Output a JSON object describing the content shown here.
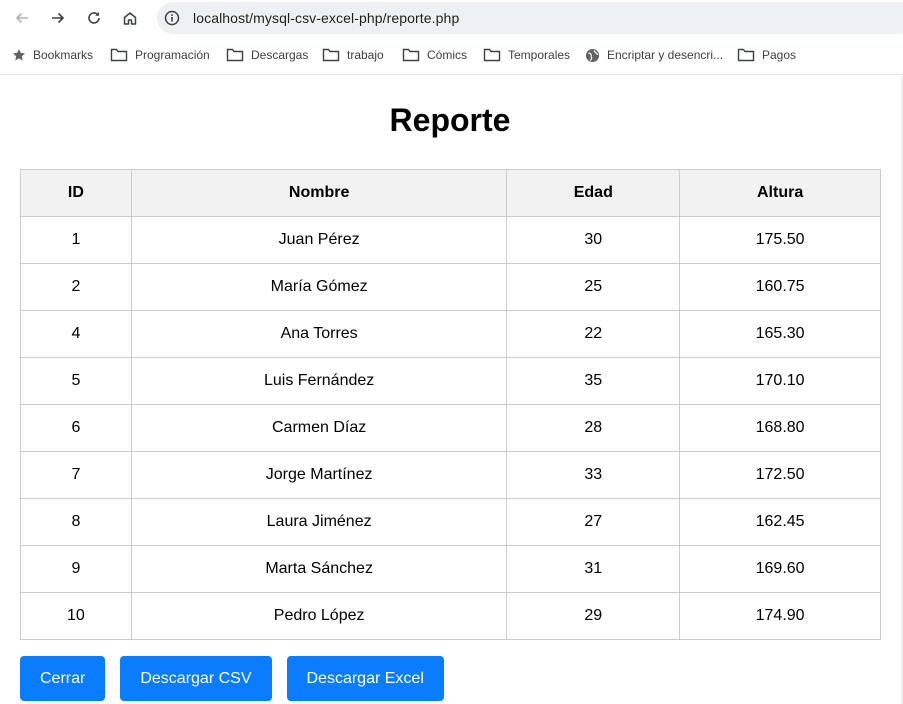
{
  "browser": {
    "url": "localhost/mysql-csv-excel-php/reporte.php",
    "bookmarks": [
      {
        "label": "Bookmarks",
        "icon": "star-icon"
      },
      {
        "label": "Programación",
        "icon": "folder-icon"
      },
      {
        "label": "Descargas",
        "icon": "folder-icon"
      },
      {
        "label": "trabajo",
        "icon": "folder-icon"
      },
      {
        "label": "Cómics",
        "icon": "folder-icon"
      },
      {
        "label": "Temporales",
        "icon": "folder-icon"
      },
      {
        "label": "Encriptar y desencri...",
        "icon": "globe-icon"
      },
      {
        "label": "Pagos",
        "icon": "folder-icon"
      }
    ]
  },
  "page": {
    "title": "Reporte",
    "columns": [
      "ID",
      "Nombre",
      "Edad",
      "Altura"
    ],
    "rows": [
      [
        "1",
        "Juan Pérez",
        "30",
        "175.50"
      ],
      [
        "2",
        "María Gómez",
        "25",
        "160.75"
      ],
      [
        "4",
        "Ana Torres",
        "22",
        "165.30"
      ],
      [
        "5",
        "Luis Fernández",
        "35",
        "170.10"
      ],
      [
        "6",
        "Carmen Díaz",
        "28",
        "168.80"
      ],
      [
        "7",
        "Jorge Martínez",
        "33",
        "172.50"
      ],
      [
        "8",
        "Laura Jiménez",
        "27",
        "162.45"
      ],
      [
        "9",
        "Marta Sánchez",
        "31",
        "169.60"
      ],
      [
        "10",
        "Pedro López",
        "29",
        "174.90"
      ]
    ],
    "buttons": {
      "close": "Cerrar",
      "csv": "Descargar CSV",
      "excel": "Descargar Excel"
    }
  },
  "colors": {
    "button_bg": "#0a7cff",
    "header_bg": "#f2f2f2",
    "border": "#cccccc"
  }
}
